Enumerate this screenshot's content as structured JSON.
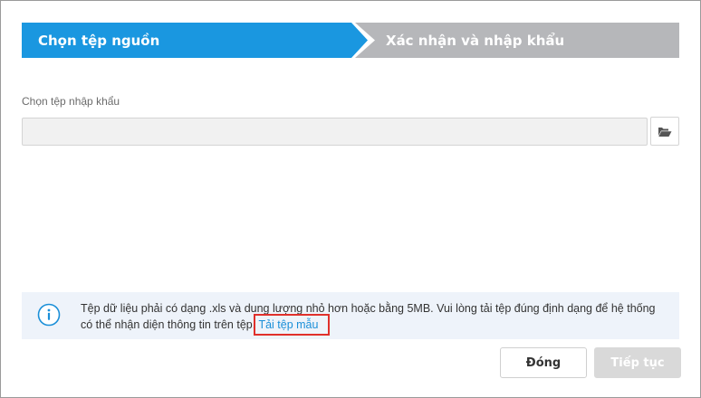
{
  "stepper": {
    "steps": [
      {
        "label": "Chọn tệp nguồn",
        "state": "active"
      },
      {
        "label": "Xác nhận và nhập khẩu",
        "state": "inactive"
      }
    ],
    "active_color": "#1a97e0",
    "inactive_color": "#b6b7ba"
  },
  "file_field": {
    "label": "Chọn tệp nhập khẩu",
    "value": "",
    "browse_icon": "folder-open-icon"
  },
  "info": {
    "icon": "info-circle-icon",
    "text": "Tệp dữ liệu phải có dạng .xls và dung lượng nhỏ hơn hoặc bằng 5MB. Vui lòng tải tệp đúng định dạng để hệ thống có thể nhận diện thông tin trên tệp.",
    "link_label": "Tải tệp mẫu",
    "link_color": "#1a8fd8",
    "highlight_color": "#e0302b"
  },
  "footer": {
    "close_label": "Đóng",
    "next_label": "Tiếp tục"
  }
}
